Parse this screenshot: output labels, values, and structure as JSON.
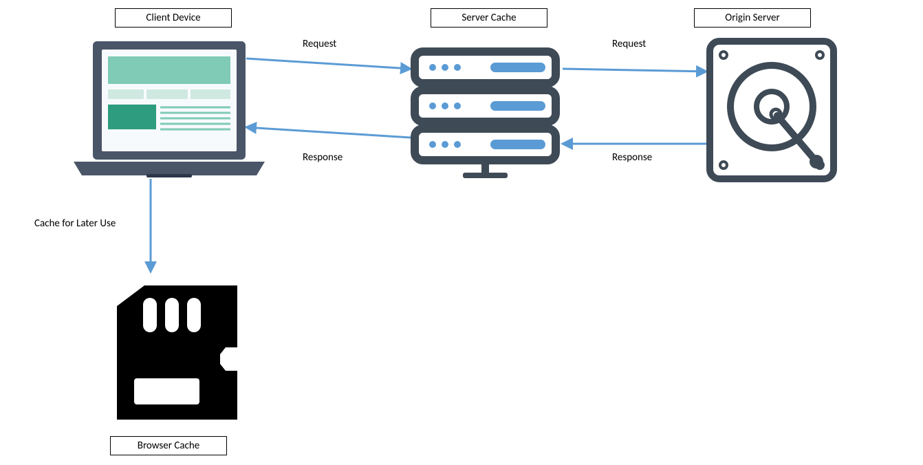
{
  "labels": {
    "clientDevice": "Client Device",
    "serverCache": "Server Cache",
    "originServer": "Origin Server",
    "browserCache": "Browser Cache"
  },
  "arrows": {
    "requestTop": "Request",
    "requestRight": "Request",
    "responseLeft": "Response",
    "responseRight": "Response",
    "cacheDown": "Cache for Later Use"
  }
}
